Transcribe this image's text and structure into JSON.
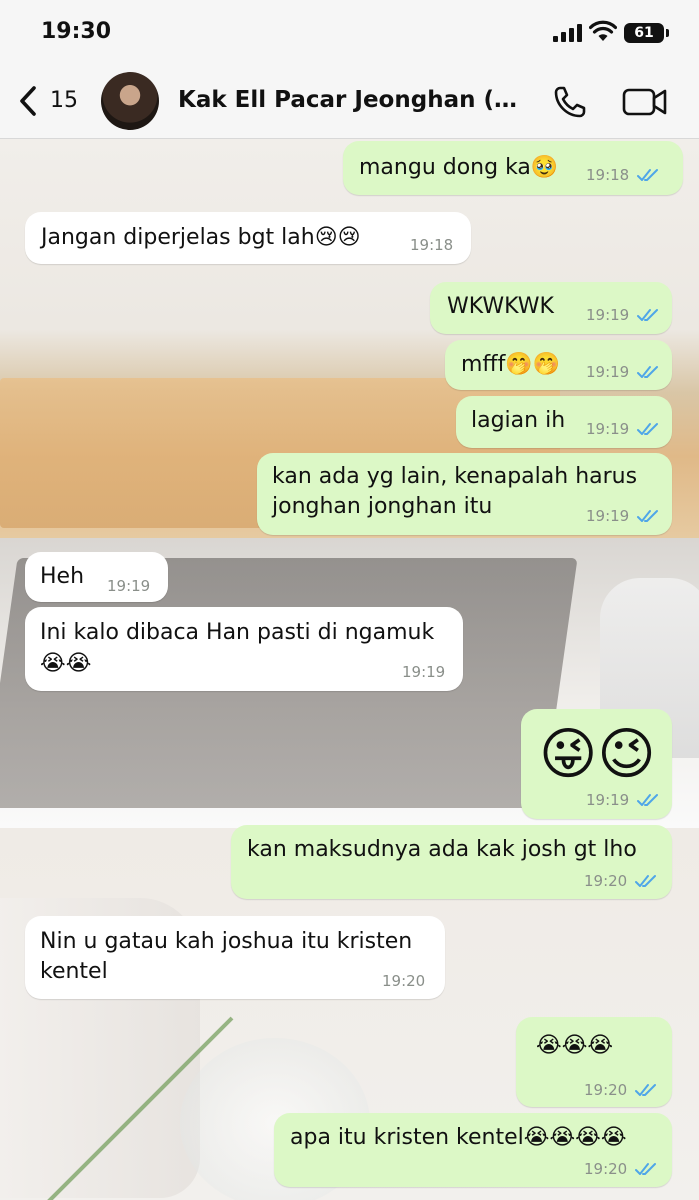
{
  "status_bar": {
    "time": "19:30",
    "battery": "61"
  },
  "header": {
    "back_count": "15",
    "contact_name": "Kak Ell Pacar Jeonghan (k..."
  },
  "messages": [
    {
      "dir": "out",
      "text": "mangu dong ka🥹",
      "time": "19:18",
      "read": true
    },
    {
      "dir": "in",
      "text": "Jangan diperjelas bgt lah😢😢",
      "time": "19:18"
    },
    {
      "dir": "out",
      "text": "WKWKWK",
      "time": "19:19",
      "read": true
    },
    {
      "dir": "out",
      "text": "mfff🤭🤭",
      "time": "19:19",
      "read": true
    },
    {
      "dir": "out",
      "text": "lagian ih",
      "time": "19:19",
      "read": true
    },
    {
      "dir": "out",
      "line1": "kan ada yg lain, kenapalah harus",
      "line2": "jonghan jonghan itu",
      "time": "19:19",
      "read": true
    },
    {
      "dir": "in",
      "text": "Heh",
      "time": "19:19"
    },
    {
      "dir": "in",
      "line1": "Ini kalo dibaca Han pasti di ngamuk",
      "line2": "😭😭",
      "time": "19:19"
    },
    {
      "dir": "out",
      "text": "😜😉",
      "time": "19:19",
      "read": true
    },
    {
      "dir": "out",
      "text": "kan maksudnya ada kak josh gt lho",
      "time": "19:20",
      "read": true
    },
    {
      "dir": "in",
      "line1": "Nin u gatau kah joshua itu kristen",
      "line2": "kentel",
      "time": "19:20"
    },
    {
      "dir": "out",
      "text": "😭😭😭",
      "time": "19:20",
      "read": true
    },
    {
      "dir": "out",
      "text": "apa itu kristen kentel😭😭😭😭",
      "time": "19:20",
      "read": true
    }
  ],
  "colors": {
    "outgoing": "#dcf8c6",
    "incoming": "#ffffff",
    "read_ticks": "#4fa6e8"
  }
}
